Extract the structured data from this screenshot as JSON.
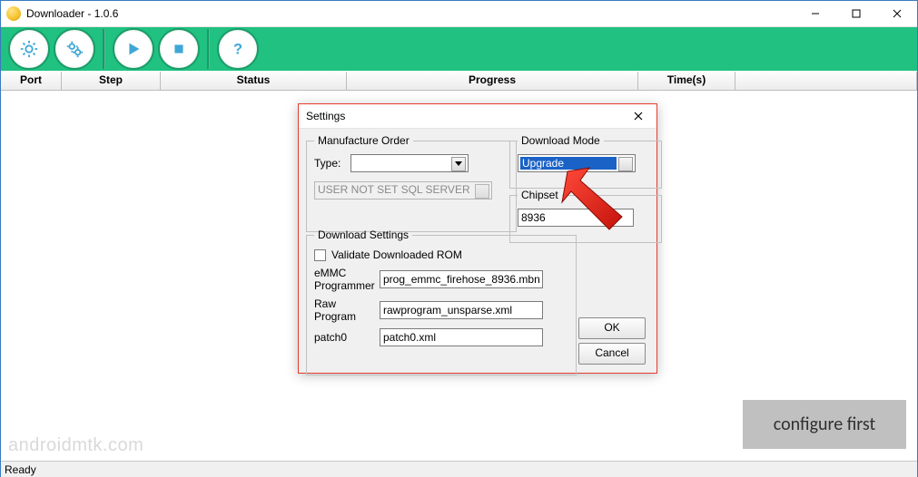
{
  "window": {
    "title": "Downloader - 1.0.6"
  },
  "columns": {
    "port": "Port",
    "step": "Step",
    "status": "Status",
    "progress": "Progress",
    "time": "Time(s)"
  },
  "status": "Ready",
  "watermark": "androidmtk.com",
  "annotation": "configure first",
  "dialog": {
    "title": "Settings",
    "manufacture": {
      "legend": "Manufacture Order",
      "type_label": "Type:",
      "type_value": "",
      "server_value": "USER NOT SET SQL SERVER"
    },
    "mode": {
      "legend": "Download Mode",
      "value": "Upgrade"
    },
    "chipset": {
      "legend": "Chipset",
      "value": "8936"
    },
    "dl": {
      "legend": "Download Settings",
      "validate_label": "Validate Downloaded ROM",
      "emmc_label": "eMMC Programmer",
      "emmc_value": "prog_emmc_firehose_8936.mbn",
      "raw_label": "Raw Program",
      "raw_value": "rawprogram_unsparse.xml",
      "patch_label": "patch0",
      "patch_value": "patch0.xml"
    },
    "ok": "OK",
    "cancel": "Cancel"
  }
}
